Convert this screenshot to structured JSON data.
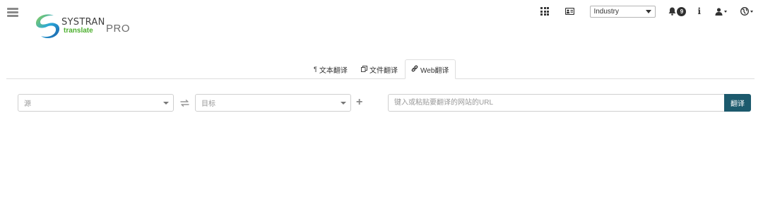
{
  "logo": {
    "brand": "SYSTRAN",
    "sub": "translate",
    "pro": "PRO"
  },
  "topbar": {
    "domain_value": "Industry",
    "notifications_count": "9",
    "info_label": "i"
  },
  "tabs": [
    {
      "label": "文本翻译",
      "icon": "pilcrow-icon",
      "active": false
    },
    {
      "label": "文件翻译",
      "icon": "copy-icon",
      "active": false
    },
    {
      "label": "Web翻译",
      "icon": "link-icon",
      "active": true
    }
  ],
  "form": {
    "source_placeholder": "源",
    "target_placeholder": "目标",
    "url_placeholder": "键入或粘贴要翻译的网站的URL",
    "url_value": "",
    "translate_label": "翻译"
  },
  "colors": {
    "accent": "#1c5a6d",
    "brand_green": "#4caf2e",
    "brand_blue": "#1a8fc9"
  }
}
